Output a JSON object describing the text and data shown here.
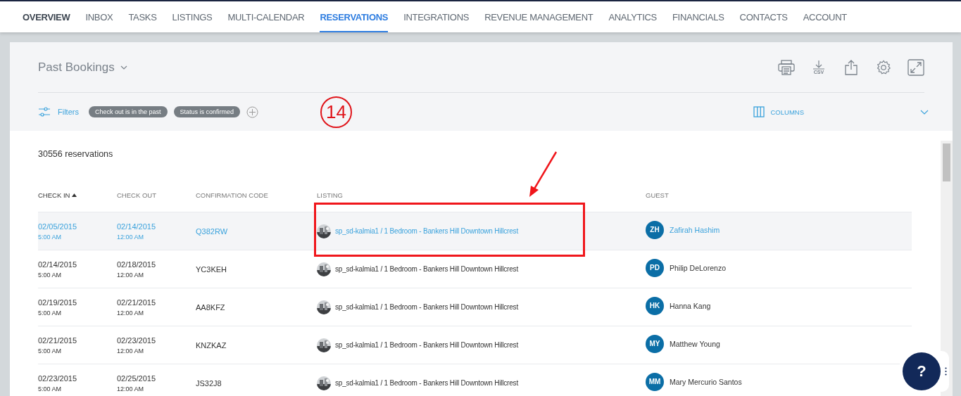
{
  "nav": {
    "items": [
      {
        "label": "OVERVIEW",
        "selected": false,
        "emphasis": true
      },
      {
        "label": "INBOX",
        "selected": false,
        "emphasis": false
      },
      {
        "label": "TASKS",
        "selected": false,
        "emphasis": false
      },
      {
        "label": "LISTINGS",
        "selected": false,
        "emphasis": false
      },
      {
        "label": "MULTI-CALENDAR",
        "selected": false,
        "emphasis": false
      },
      {
        "label": "RESERVATIONS",
        "selected": true,
        "emphasis": false
      },
      {
        "label": "INTEGRATIONS",
        "selected": false,
        "emphasis": false
      },
      {
        "label": "REVENUE MANAGEMENT",
        "selected": false,
        "emphasis": false
      },
      {
        "label": "ANALYTICS",
        "selected": false,
        "emphasis": false
      },
      {
        "label": "FINANCIALS",
        "selected": false,
        "emphasis": false
      },
      {
        "label": "CONTACTS",
        "selected": false,
        "emphasis": false
      },
      {
        "label": "ACCOUNT",
        "selected": false,
        "emphasis": false
      }
    ]
  },
  "view": {
    "title": "Past Bookings",
    "csv_label": "CSV"
  },
  "filters": {
    "label": "Filters",
    "chips": [
      "Check out is in the past",
      "Status is confirmed"
    ],
    "columns_label": "COLUMNS"
  },
  "count": "30556 reservations",
  "table": {
    "columns": [
      {
        "label": "CHECK IN",
        "sorted": true
      },
      {
        "label": "CHECK OUT",
        "sorted": false
      },
      {
        "label": "CONFIRMATION CODE",
        "sorted": false
      },
      {
        "label": "LISTING",
        "sorted": false
      },
      {
        "label": "GUEST",
        "sorted": false
      }
    ],
    "rows": [
      {
        "selected": true,
        "check_in": "02/05/2015",
        "check_in_time": "5:00 AM",
        "check_out": "02/14/2015",
        "check_out_time": "12:00 AM",
        "code": "Q382RW",
        "listing": "sp_sd-kalmia1 / 1 Bedroom - Bankers Hill Downtown Hillcrest",
        "initials": "ZH",
        "guest": "Zafirah Hashim"
      },
      {
        "selected": false,
        "check_in": "02/14/2015",
        "check_in_time": "5:00 AM",
        "check_out": "02/18/2015",
        "check_out_time": "12:00 AM",
        "code": "YC3KEH",
        "listing": "sp_sd-kalmia1 / 1 Bedroom - Bankers Hill Downtown Hillcrest",
        "initials": "PD",
        "guest": "Philip DeLorenzo"
      },
      {
        "selected": false,
        "check_in": "02/19/2015",
        "check_in_time": "5:00 AM",
        "check_out": "02/21/2015",
        "check_out_time": "12:00 AM",
        "code": "AA8KFZ",
        "listing": "sp_sd-kalmia1 / 1 Bedroom - Bankers Hill Downtown Hillcrest",
        "initials": "HK",
        "guest": "Hanna Kang"
      },
      {
        "selected": false,
        "check_in": "02/21/2015",
        "check_in_time": "5:00 AM",
        "check_out": "02/23/2015",
        "check_out_time": "12:00 AM",
        "code": "KNZKAZ",
        "listing": "sp_sd-kalmia1 / 1 Bedroom - Bankers Hill Downtown Hillcrest",
        "initials": "MY",
        "guest": "Matthew Young"
      },
      {
        "selected": false,
        "check_in": "02/23/2015",
        "check_in_time": "5:00 AM",
        "check_out": "02/25/2015",
        "check_out_time": "12:00 AM",
        "code": "JS32J8",
        "listing": "sp_sd-kalmia1 / 1 Bedroom - Bankers Hill Downtown Hillcrest",
        "initials": "MM",
        "guest": "Mary Mercurio Santos"
      }
    ]
  },
  "help": {
    "label": "?"
  },
  "annotation": {
    "number": "14"
  }
}
